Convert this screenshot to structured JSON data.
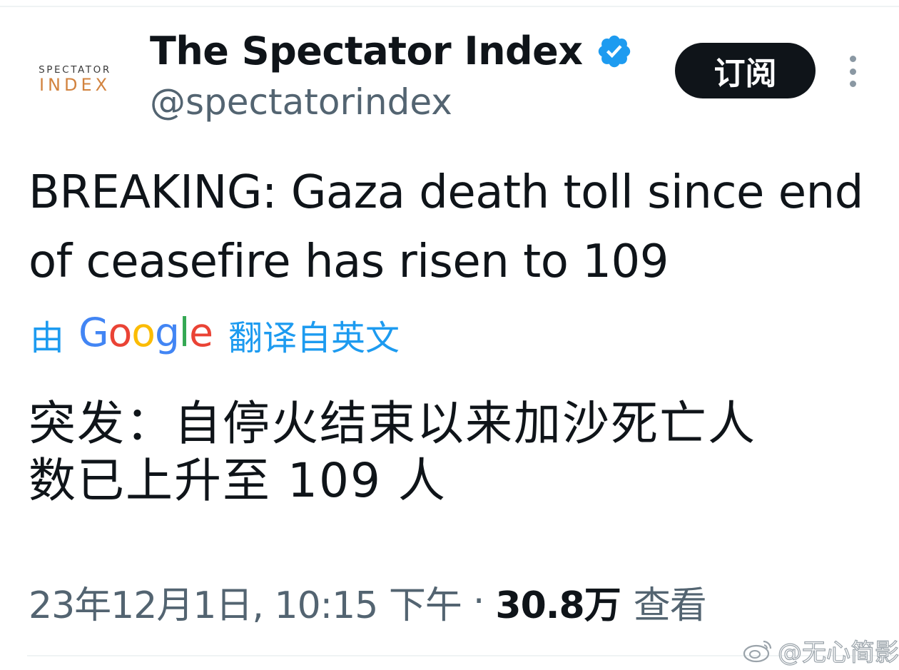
{
  "account": {
    "avatar_line1": "SPECTATOR",
    "avatar_line2": "INDEX",
    "display_name": "The Spectator Index",
    "handle": "@spectatorindex",
    "verified_icon": "verified-badge-icon",
    "subscribe_label": "订阅",
    "more_icon": "more-vertical-icon"
  },
  "tweet": {
    "text": "BREAKING: Gaza death toll since end of ceasefire has risen to 109"
  },
  "translation": {
    "by_label": "由",
    "google_letters": [
      "G",
      "o",
      "o",
      "g",
      "l",
      "e"
    ],
    "from_label": "翻译自英文",
    "translated_text_line1": "突发：自停火结束以来加沙死亡人",
    "translated_text_line2": "数已上升至 109 人"
  },
  "meta": {
    "timestamp": "23年12月1日, 10:15 下午",
    "separator": "·",
    "views_count": "30.8万",
    "views_label": "查看"
  },
  "watermark": {
    "text": "@无心简影",
    "icon": "weibo-logo-icon"
  },
  "colors": {
    "link_blue": "#1d9bf0",
    "secondary_text": "#536471",
    "primary_text": "#0f1419",
    "verified_blue": "#1d9bf0",
    "avatar_accent": "#d2833f"
  }
}
